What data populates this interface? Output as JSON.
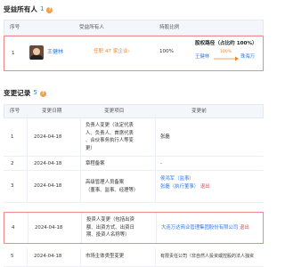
{
  "beneficiary_section": {
    "title": "受益所有人",
    "count": "1",
    "help_glyph": "?",
    "headers": [
      "序号",
      "受益所有人",
      "持股比例"
    ],
    "row": {
      "seq": "1",
      "name": "王健林",
      "role": "任职 47 家企业",
      "role_arrow": "›",
      "percent": "100%",
      "path_title": "股权路径（占比约 100%）",
      "path_from": "王健林",
      "path_pct": "100%",
      "path_to": "珠海万"
    }
  },
  "changes_section": {
    "title": "变更记录",
    "count": "5",
    "help_glyph": "?",
    "headers": [
      "序号",
      "变更日期",
      "变更项目",
      "变更前"
    ],
    "rows": [
      {
        "seq": "1",
        "date": "2024-04-18",
        "item": [
          "负责人变更（法定代表",
          "人、负责人、首席代表",
          "、合伙事务执行人等变",
          "更）"
        ],
        "before": [
          "张磊"
        ],
        "before_suffix": ""
      },
      {
        "seq": "2",
        "date": "2024-04-18",
        "item": [
          "章程备案"
        ],
        "before": [
          "-"
        ],
        "before_suffix": ""
      },
      {
        "seq": "3",
        "date": "2024-04-18",
        "item": [
          "高级管理人员备案",
          "（董事、监事、经理等）"
        ],
        "before": [
          "侯鸿军（监事）",
          "张磊（执行董事）"
        ],
        "before_suffix": "退出"
      },
      {
        "seq": "4",
        "date": "2024-04-18",
        "item": [
          "投资人变更（包括出资",
          "额、出资方式、出资日",
          "期、投资人名称等）"
        ],
        "before": [
          "大连万达商业管理集团股份有限公司"
        ],
        "before_suffix": "退出"
      },
      {
        "seq": "5",
        "date": "2024-04-18",
        "item": [
          "市场主体类型变更"
        ],
        "before": [
          "有限责任公司（非自然人投资或控股的法人独资"
        ],
        "before_suffix": ""
      }
    ]
  },
  "colors": {
    "accent": "#2c7be5",
    "highlight_border": "#f08a8a",
    "orange": "#f0862a",
    "red": "#e24a4a"
  }
}
